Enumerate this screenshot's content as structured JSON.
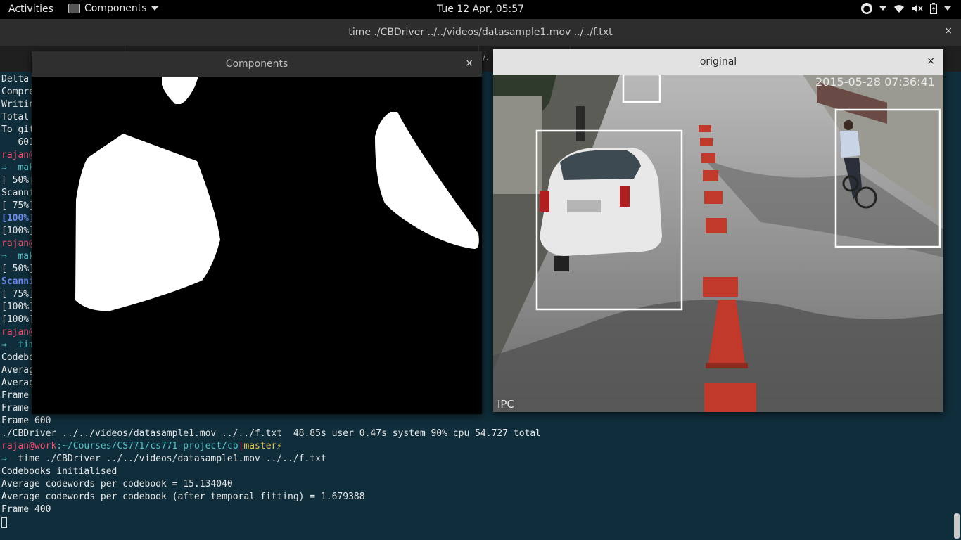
{
  "topbar": {
    "activities": "Activities",
    "app_menu": "Components",
    "clock": "Tue 12 Apr, 05:57"
  },
  "terminal": {
    "title": "time ./CBDriver ../../videos/datasample1.mov ../../f.txt",
    "tab_fragment": "/.",
    "left_column": [
      "Delta",
      "Compre",
      "Writin",
      "Total",
      "To git",
      "   601",
      "rajan@",
      "⇒  mak",
      "[ 50%]",
      "Scanni",
      "[ 75%]",
      "[100%]",
      "[100%]",
      "rajan@",
      "⇒  mak",
      "[ 50%]",
      "Scanni",
      "[ 75%]",
      "[100%]",
      "[100%]",
      "rajan@",
      "⇒  tim",
      "Codebo",
      "Averag",
      "Averag",
      "Frame",
      "Frame"
    ],
    "lines": {
      "frame600": "Frame 600",
      "timing": "./CBDriver ../../videos/datasample1.mov ../../f.txt  48.85s user 0.47s system 90% cpu 54.727 total",
      "prompt_user": "rajan",
      "prompt_host": "@work",
      "prompt_path": ":~/Courses/CS771/cs771-project/cb",
      "prompt_sep": "|",
      "prompt_branch": "master⚡",
      "command_arrow": "⇒",
      "command": "  time ./CBDriver ../../videos/datasample1.mov ../../f.txt",
      "codebooks": "Codebooks initialised",
      "avg1": "Average codewords per codebook = 15.134040",
      "avg2": "Average codewords per codebook (after temporal fitting) = 1.679388",
      "frame400": "Frame 400"
    }
  },
  "components_window": {
    "title": "Components",
    "close": "×"
  },
  "original_window": {
    "title": "original",
    "close": "×",
    "timestamp": "2015-05-28 07:36:41",
    "watermark": "IPC"
  },
  "close_glyph": "×",
  "colors": {
    "terminal_bg": "#0f2d3a",
    "prompt_user": "#f05070",
    "prompt_path": "#56c2c8",
    "git_branch": "#e8c84a",
    "bold_blue": "#6e8cf0",
    "bounding_box": "#ffffff"
  }
}
